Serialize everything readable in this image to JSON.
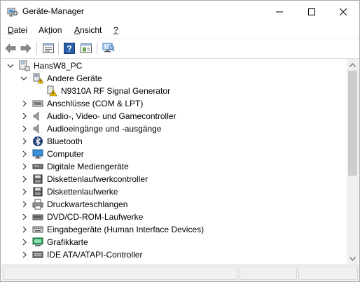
{
  "window": {
    "title": "Geräte-Manager"
  },
  "menu": {
    "items": [
      {
        "pre": "",
        "ul": "D",
        "post": "atei"
      },
      {
        "pre": "Ak",
        "ul": "t",
        "post": "ion"
      },
      {
        "pre": "",
        "ul": "A",
        "post": "nsicht"
      },
      {
        "pre": "",
        "ul": "?",
        "post": ""
      }
    ]
  },
  "toolbar": {
    "icons": [
      "back-icon",
      "forward-icon",
      "properties-icon",
      "help-icon",
      "view-icon",
      "scan-hardware-icon"
    ]
  },
  "tree": {
    "root": "HansW8_PC",
    "other_devices": "Andere Geräte",
    "unknown_device": "N9310A RF Signal Generator",
    "categories": [
      "Anschlüsse (COM & LPT)",
      "Audio-, Video- und Gamecontroller",
      "Audioeingänge und -ausgänge",
      "Bluetooth",
      "Computer",
      "Digitale Mediengeräte",
      "Diskettenlaufwerkcontroller",
      "Diskettenlaufwerke",
      "Druckwarteschlangen",
      "DVD/CD-ROM-Laufwerke",
      "Eingabegeräte (Human Interface Devices)",
      "Grafikkarte",
      "IDE ATA/ATAPI-Controller"
    ]
  },
  "colors": {
    "accent_blue": "#1f6fb5",
    "warning_yellow": "#f5c400",
    "scrollbar_thumb": "#cdcdcd"
  }
}
